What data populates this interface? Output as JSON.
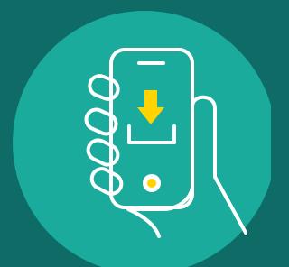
{
  "illustration": {
    "icon": "hand-holding-phone-download-icon",
    "colors": {
      "background": "#0e6b66",
      "circle": "#1aab9c",
      "outline": "#ffffff",
      "accent": "#ffd400"
    }
  }
}
